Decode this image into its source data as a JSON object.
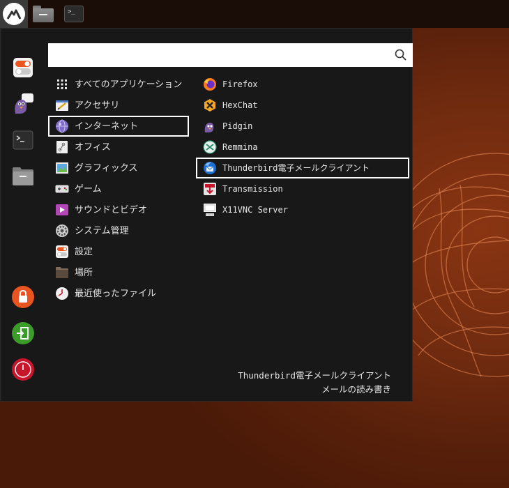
{
  "panel": {
    "logo_icon": "mountain-logo-icon",
    "launchers": [
      {
        "name": "file-manager-launcher",
        "icon": "folder-icon"
      },
      {
        "name": "terminal-launcher",
        "icon": "terminal-icon",
        "glyph": ">_"
      }
    ]
  },
  "menu": {
    "search": {
      "value": "",
      "placeholder": ""
    },
    "favorites": [
      {
        "name": "settings",
        "icon": "toggle-settings-icon"
      },
      {
        "name": "pidgin",
        "icon": "pidgin-bird-icon"
      },
      {
        "name": "terminal",
        "icon": "terminal-icon"
      },
      {
        "name": "files",
        "icon": "folder-icon"
      }
    ],
    "actions": [
      {
        "name": "lock",
        "icon": "lock-icon",
        "color": "#e95420"
      },
      {
        "name": "logout",
        "icon": "logout-icon",
        "color": "#3c9c2a"
      },
      {
        "name": "shutdown",
        "icon": "power-icon",
        "color": "#c7162b"
      }
    ],
    "categories": [
      {
        "label": "すべてのアプリケーション",
        "icon": "grid-icon"
      },
      {
        "label": "アクセサリ",
        "icon": "accessories-icon"
      },
      {
        "label": "インターネット",
        "icon": "internet-globe-icon",
        "selected": true
      },
      {
        "label": "オフィス",
        "icon": "office-icon"
      },
      {
        "label": "グラフィックス",
        "icon": "graphics-icon"
      },
      {
        "label": "ゲーム",
        "icon": "gamepad-icon"
      },
      {
        "label": "サウンドとビデオ",
        "icon": "multimedia-icon"
      },
      {
        "label": "システム管理",
        "icon": "system-gear-icon"
      },
      {
        "label": "設定",
        "icon": "settings-toggle-icon"
      },
      {
        "label": "場所",
        "icon": "places-folder-icon"
      },
      {
        "label": "最近使ったファイル",
        "icon": "recent-clock-icon"
      }
    ],
    "apps": [
      {
        "label": "Firefox",
        "icon": "firefox-icon"
      },
      {
        "label": "HexChat",
        "icon": "hexchat-icon"
      },
      {
        "label": "Pidgin",
        "icon": "pidgin-icon"
      },
      {
        "label": "Remmina",
        "icon": "remmina-icon"
      },
      {
        "label": "Thunderbird電子メールクライアント",
        "icon": "thunderbird-icon",
        "selected": true
      },
      {
        "label": "Transmission",
        "icon": "transmission-icon"
      },
      {
        "label": "X11VNC Server",
        "icon": "vnc-icon"
      }
    ],
    "description": {
      "title": "Thunderbird電子メールクライアント",
      "subtitle": "メールの読み書き"
    }
  },
  "colors": {
    "menu_bg": "#181818",
    "selection_border": "#ffffff",
    "desktop_accent": "#e95420"
  }
}
